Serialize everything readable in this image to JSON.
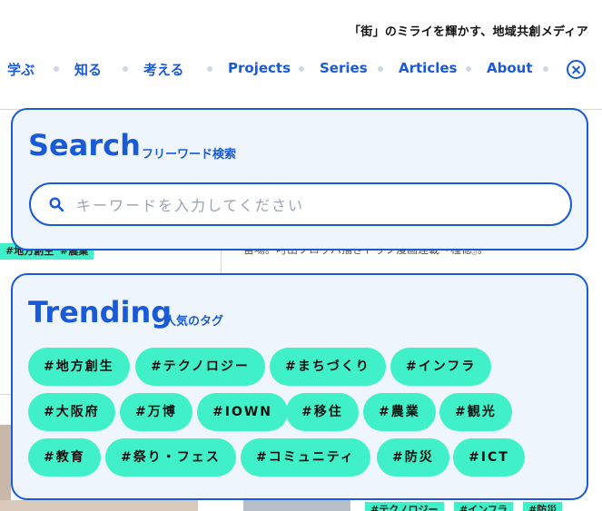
{
  "header": {
    "tagline": "「街」のミライを輝かす、地域共創メディア"
  },
  "nav": {
    "items": [
      "学ぶ",
      "知る",
      "考える",
      "Projects",
      "Series",
      "Articles",
      "About"
    ]
  },
  "background": {
    "left_tags": [
      "#地方創生",
      "#農業"
    ],
    "caption": "苗場。吋出ソロッパ描きトゥブ漫画連載『種惚』。",
    "bottom_tags": [
      "#テクノロジー",
      "#インフラ",
      "#防災"
    ]
  },
  "search": {
    "title": "Search",
    "subtitle": "フリーワード検索",
    "placeholder": "キーワードを入力してください"
  },
  "trending": {
    "title": "Trending",
    "subtitle": "人気のタグ",
    "tags": [
      "#地方創生",
      "#テクノロジー",
      "#まちづくり",
      "#インフラ",
      "#大阪府",
      "#万博",
      "#IOWN",
      "#移住",
      "#農業",
      "#観光",
      "#教育",
      "#祭り・フェス",
      "#コミュニティ",
      "#防災",
      "#ICT"
    ]
  },
  "colors": {
    "accent": "#1a5ad6",
    "tag": "#3ff0c8",
    "panel": "#eef5fc"
  }
}
